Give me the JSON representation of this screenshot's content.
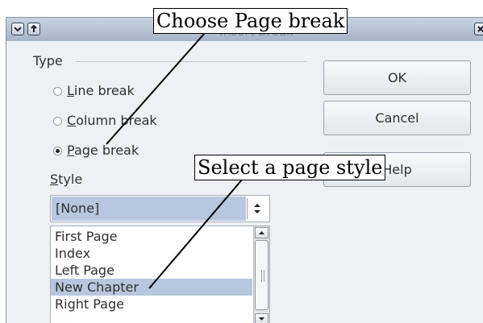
{
  "window": {
    "title": "Insert Break"
  },
  "type_section": {
    "label": "Type",
    "options": [
      {
        "prefix": "",
        "mnemonic": "L",
        "rest": "ine break",
        "checked": false
      },
      {
        "prefix": "",
        "mnemonic": "C",
        "rest": "olumn break",
        "checked": false
      },
      {
        "prefix": "",
        "mnemonic": "P",
        "rest": "age break",
        "checked": true
      }
    ]
  },
  "style_section": {
    "mnemonic": "S",
    "rest": "tyle",
    "selected": "[None]",
    "items": [
      "First Page",
      "Index",
      "Left Page",
      "New Chapter",
      "Right Page"
    ],
    "highlighted_item": "New Chapter"
  },
  "buttons": {
    "ok": "OK",
    "cancel": "Cancel",
    "help": "Help"
  },
  "annotations": {
    "callout_top": "Choose Page break",
    "callout_mid": "Select a page style"
  },
  "colors": {
    "selection": "#b8c7df",
    "titlebar": "#a5b3c7",
    "dialog_bg": "#eef0f3"
  }
}
